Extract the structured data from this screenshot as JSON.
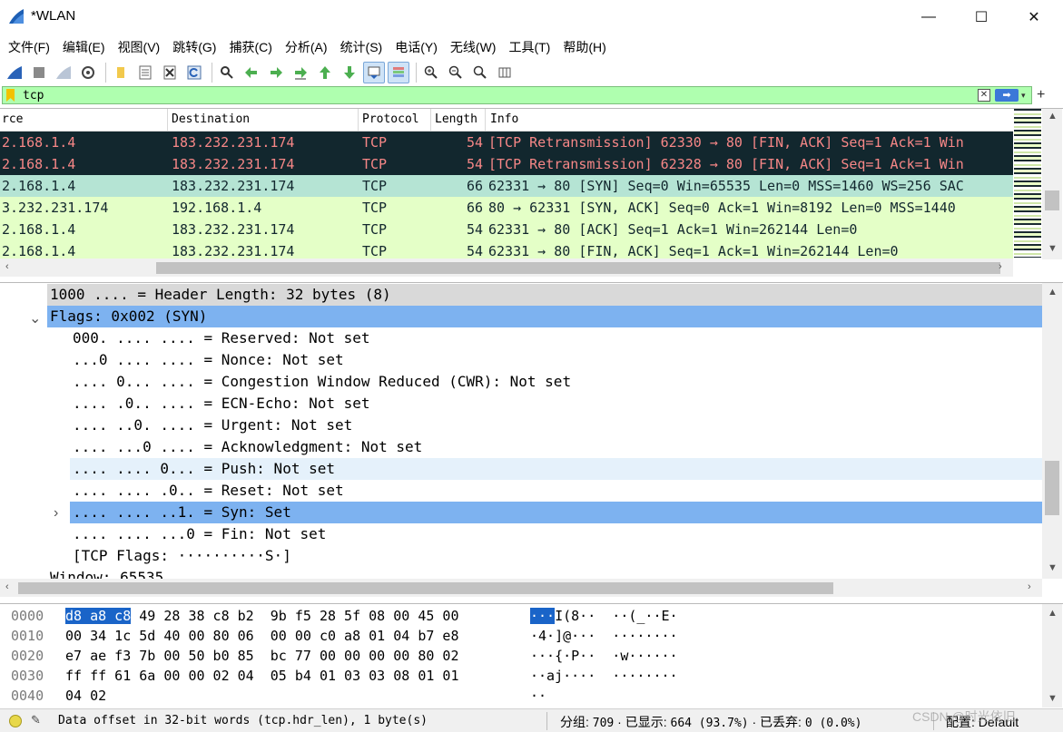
{
  "window": {
    "title": "*WLAN",
    "minimize": "—",
    "maximize": "☐",
    "close": "✕"
  },
  "menu": [
    "文件(F)",
    "编辑(E)",
    "视图(V)",
    "跳转(G)",
    "捕获(C)",
    "分析(A)",
    "统计(S)",
    "电话(Y)",
    "无线(W)",
    "工具(T)",
    "帮助(H)"
  ],
  "toolbar": {
    "icons": [
      "shark-fin-start-icon",
      "stop-square-icon",
      "restart-fin-icon",
      "gear-options-icon",
      "open-folder-icon",
      "save-file-icon",
      "close-file-icon",
      "reload-icon",
      "search-icon",
      "go-back-icon",
      "go-forward-icon",
      "go-to-packet-icon",
      "first-packet-icon",
      "last-packet-icon",
      "autoscroll-icon",
      "colorize-icon",
      "zoom-in-icon",
      "zoom-out-icon",
      "zoom-normal-icon",
      "resize-columns-icon"
    ]
  },
  "filter": {
    "value": "tcp",
    "apply": "➡"
  },
  "packet_list": {
    "columns": {
      "source": "rce",
      "destination": "Destination",
      "protocol": "Protocol",
      "length": "Length",
      "info": "Info"
    },
    "rows": [
      {
        "source": "2.168.1.4",
        "destination": "183.232.231.174",
        "protocol": "TCP",
        "length": "54",
        "info": "[TCP Retransmission] 62330 → 80 [FIN, ACK] Seq=1 Ack=1 Win",
        "bg": "#12272e",
        "fg": "#f78787"
      },
      {
        "source": "2.168.1.4",
        "destination": "183.232.231.174",
        "protocol": "TCP",
        "length": "54",
        "info": "[TCP Retransmission] 62328 → 80 [FIN, ACK] Seq=1 Ack=1 Win",
        "bg": "#12272e",
        "fg": "#f78787"
      },
      {
        "source": "2.168.1.4",
        "destination": "183.232.231.174",
        "protocol": "TCP",
        "length": "66",
        "info": "62331 → 80 [SYN] Seq=0 Win=65535 Len=0 MSS=1460 WS=256 SAC",
        "bg": "#b5e4d4",
        "fg": "#12272e"
      },
      {
        "source": "3.232.231.174",
        "destination": "192.168.1.4",
        "protocol": "TCP",
        "length": "66",
        "info": "80 → 62331 [SYN, ACK] Seq=0 Ack=1 Win=8192 Len=0 MSS=1440",
        "bg": "#e4ffc7",
        "fg": "#12272e"
      },
      {
        "source": "2.168.1.4",
        "destination": "183.232.231.174",
        "protocol": "TCP",
        "length": "54",
        "info": "62331 → 80 [ACK] Seq=1 Ack=1 Win=262144 Len=0",
        "bg": "#e4ffc7",
        "fg": "#12272e"
      },
      {
        "source": "2.168.1.4",
        "destination": "183.232.231.174",
        "protocol": "TCP",
        "length": "54",
        "info": "62331 → 80 [FIN, ACK] Seq=1 Ack=1 Win=262144 Len=0",
        "bg": "#e4ffc7",
        "fg": "#12272e"
      }
    ]
  },
  "details": {
    "rows": [
      {
        "text": "1000 .... = Header Length: 32 bytes (8)",
        "indent": 55,
        "state": "gray"
      },
      {
        "text": "Flags: 0x002 (SYN)",
        "indent": 55,
        "state": "selected",
        "expander": "⌄"
      },
      {
        "text": "000. .... .... = Reserved: Not set",
        "indent": 80,
        "state": "none"
      },
      {
        "text": "...0 .... .... = Nonce: Not set",
        "indent": 80,
        "state": "none"
      },
      {
        "text": ".... 0... .... = Congestion Window Reduced (CWR): Not set",
        "indent": 80,
        "state": "none"
      },
      {
        "text": ".... .0.. .... = ECN-Echo: Not set",
        "indent": 80,
        "state": "none"
      },
      {
        "text": ".... ..0. .... = Urgent: Not set",
        "indent": 80,
        "state": "none"
      },
      {
        "text": ".... ...0 .... = Acknowledgment: Not set",
        "indent": 80,
        "state": "none"
      },
      {
        "text": ".... .... 0... = Push: Not set",
        "indent": 80,
        "state": "hover"
      },
      {
        "text": ".... .... .0.. = Reset: Not set",
        "indent": 80,
        "state": "none"
      },
      {
        "text": ".... .... ..1. = Syn: Set",
        "indent": 80,
        "state": "selected",
        "expander": "›"
      },
      {
        "text": ".... .... ...0 = Fin: Not set",
        "indent": 80,
        "state": "none"
      },
      {
        "text": "[TCP Flags: ··········S·]",
        "indent": 80,
        "state": "none"
      },
      {
        "text": "Window: 65535",
        "indent": 55,
        "state": "none"
      }
    ]
  },
  "bytes": {
    "rows": [
      {
        "offset": "0000",
        "hex_sel": "d8 a8 c8",
        "hex_rest": " 49 28 38 c8 b2  9b f5 28 5f 08 00 45 00",
        "ascii_sel": "···",
        "ascii_rest": "I(8··  ··(_··E·"
      },
      {
        "offset": "0010",
        "hex_sel": "",
        "hex_rest": "00 34 1c 5d 40 00 80 06  00 00 c0 a8 01 04 b7 e8",
        "ascii_sel": "",
        "ascii_rest": "·4·]@···  ········"
      },
      {
        "offset": "0020",
        "hex_sel": "",
        "hex_rest": "e7 ae f3 7b 00 50 b0 85  bc 77 00 00 00 00 80 02",
        "ascii_sel": "",
        "ascii_rest": "···{·P··  ·w······"
      },
      {
        "offset": "0030",
        "hex_sel": "",
        "hex_rest": "ff ff 61 6a 00 00 02 04  05 b4 01 03 03 08 01 01",
        "ascii_sel": "",
        "ascii_rest": "··aj····  ········"
      },
      {
        "offset": "0040",
        "hex_sel": "",
        "hex_rest": "04 02",
        "ascii_sel": "",
        "ascii_rest": "··"
      }
    ]
  },
  "status": {
    "field": "Data offset in 32-bit words (tcp.hdr_len), 1 byte(s)",
    "packets_label": "分组:",
    "packets": "709",
    "displayed_label": "已显示:",
    "displayed": "664 (93.7%)",
    "dropped_label": "已丢弃:",
    "dropped": "0 (0.0%)",
    "profile": "配置: Default",
    "watermark": "CSDN @时光依旧"
  },
  "colors": {
    "selection": "#7db2f0",
    "hover": "#e5f1fb",
    "filter_ok": "#afffaf"
  }
}
